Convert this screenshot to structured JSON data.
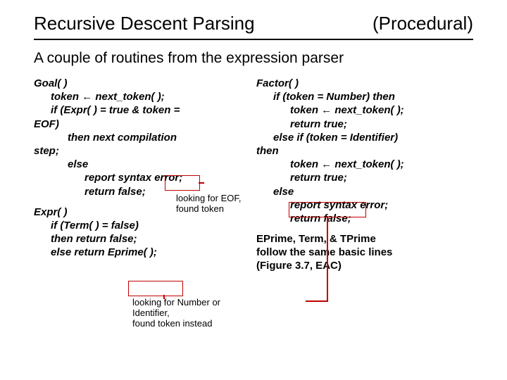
{
  "title": {
    "left": "Recursive Descent Parsing",
    "right": "(Procedural)"
  },
  "subtitle": "A couple of routines from the expression parser",
  "left_col": {
    "l0": "Goal( )",
    "l1": "token ← next_token( );",
    "l2": "if (Expr( ) = true & token =",
    "l3": "EOF)",
    "l4": "then next compilation",
    "l5": "step;",
    "l6": "else",
    "l7": "report syntax error;",
    "l8": "return false;",
    "callout1a": "looking for EOF,",
    "callout1b": "found token",
    "e0": "Expr( )",
    "e1": "if (Term( ) = false)",
    "e2": "then return false;",
    "e3": "else return Eprime( );",
    "callout2a": "looking for Number or Identifier,",
    "callout2b": "found token instead"
  },
  "right_col": {
    "f0": "Factor( )",
    "f1": "if (token = Number) then",
    "f2": "token ← next_token( );",
    "f3": "return true;",
    "f4": "else if (token = Identifier)",
    "f5": "then",
    "f6": "token ← next_token( );",
    "f7": "return true;",
    "f8": "else",
    "f9": "report syntax error;",
    "f10": "return false;",
    "n0": "EPrime, Term, & TPrime",
    "n1": "follow the same basic lines",
    "n2": "(Figure 3.7, EAC)"
  }
}
